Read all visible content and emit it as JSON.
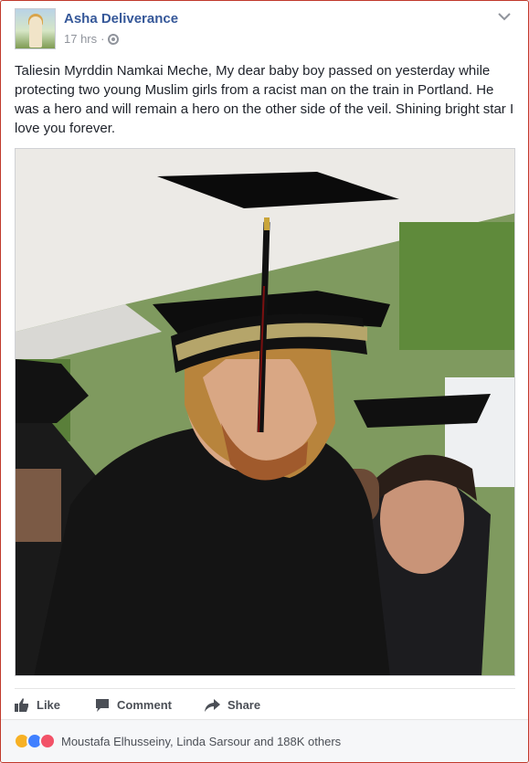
{
  "post": {
    "author": "Asha Deliverance",
    "time": "17 hrs",
    "separator": "·",
    "privacy_icon": "globe-icon",
    "text": "Taliesin Myrddin Namkai Meche, My dear baby boy passed on yesterday while protecting two young Muslim girls from a racist man on the train in Portland. He was a hero and will remain a hero on the other side of the veil. Shining bright star I love you forever."
  },
  "actions": {
    "like_label": "Like",
    "comment_label": "Comment",
    "share_label": "Share"
  },
  "reactions": {
    "icons": [
      "sad-icon",
      "like-icon",
      "love-icon"
    ],
    "summary": "Moustafa Elhusseiny, Linda Sarsour and 188K others"
  },
  "colors": {
    "link_blue": "#365899",
    "meta_gray": "#90949c",
    "action_gray": "#4b4f56",
    "border": "#c0392b"
  }
}
